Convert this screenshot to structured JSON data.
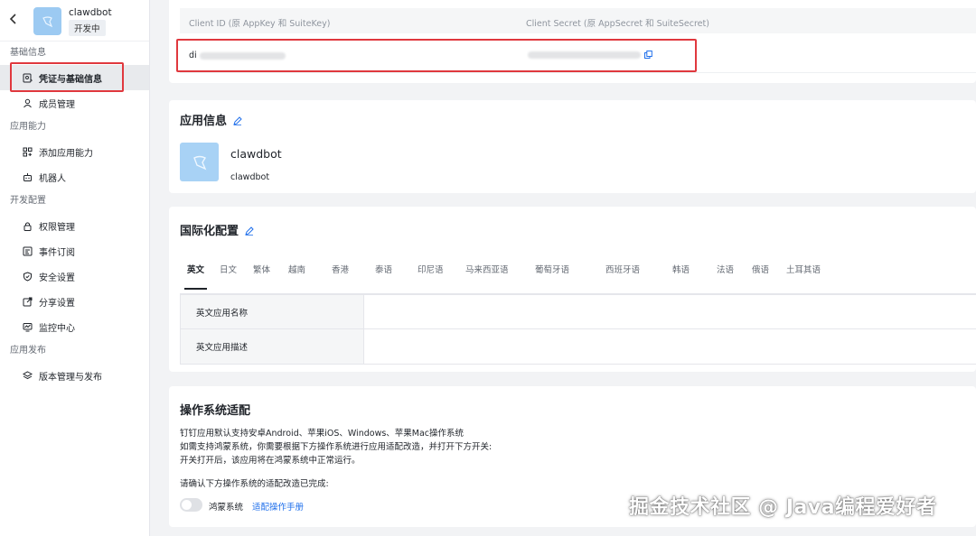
{
  "app": {
    "name": "clawdbot",
    "status": "开发中"
  },
  "sidebar": {
    "groups": [
      {
        "title": "基础信息",
        "items": [
          {
            "label": "凭证与基础信息",
            "icon": "credential-icon",
            "active": true
          },
          {
            "label": "成员管理",
            "icon": "user-icon"
          }
        ]
      },
      {
        "title": "应用能力",
        "items": [
          {
            "label": "添加应用能力",
            "icon": "grid-plus-icon"
          },
          {
            "label": "机器人",
            "icon": "robot-icon"
          }
        ]
      },
      {
        "title": "开发配置",
        "items": [
          {
            "label": "权限管理",
            "icon": "lock-icon"
          },
          {
            "label": "事件订阅",
            "icon": "event-icon"
          },
          {
            "label": "安全设置",
            "icon": "shield-icon"
          },
          {
            "label": "分享设置",
            "icon": "share-icon"
          },
          {
            "label": "监控中心",
            "icon": "monitor-icon"
          }
        ]
      },
      {
        "title": "应用发布",
        "items": [
          {
            "label": "版本管理与发布",
            "icon": "layers-icon"
          }
        ]
      }
    ]
  },
  "credentials": {
    "client_id_label": "Client ID (原 AppKey 和 SuiteKey)",
    "client_secret_label": "Client Secret (原 AppSecret 和 SuiteSecret)",
    "client_id_prefix": "di"
  },
  "app_info": {
    "title": "应用信息",
    "name": "clawdbot",
    "subtitle": "clawdbot"
  },
  "i18n": {
    "title": "国际化配置",
    "tabs": [
      "英文",
      "日文",
      "繁体",
      "越南",
      "香港",
      "泰语",
      "印尼语",
      "马来西亚语",
      "葡萄牙语",
      "西班牙语",
      "韩语",
      "法语",
      "俄语",
      "土耳其语"
    ],
    "active_tab": 0,
    "rows": [
      {
        "label": "英文应用名称"
      },
      {
        "label": "英文应用描述"
      }
    ]
  },
  "os": {
    "title": "操作系统适配",
    "desc_lines": [
      "钉钉应用默认支持安卓Android、苹果iOS、Windows、苹果Mac操作系统",
      "如需支持鸿蒙系统，你需要根据下方操作系统进行应用适配改造，并打开下方开关:",
      "开关打开后，该应用将在鸿蒙系统中正常运行。"
    ],
    "confirm": "请确认下方操作系统的适配改造已完成:",
    "system": "鸿蒙系统",
    "link": "适配操作手册"
  },
  "watermark": "掘金技术社区 @ Java编程爱好者"
}
